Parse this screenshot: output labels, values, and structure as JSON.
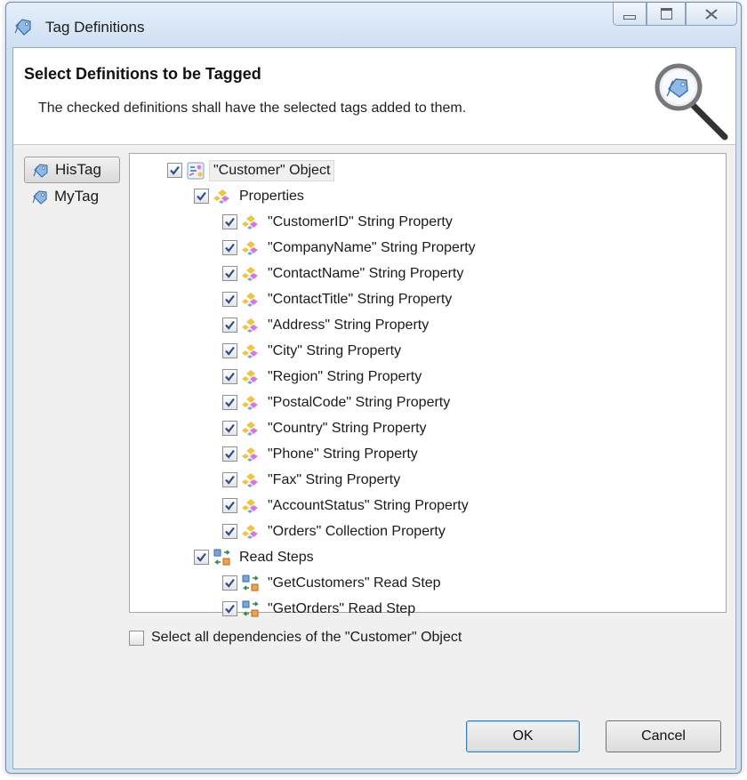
{
  "window": {
    "title": "Tag Definitions",
    "controls": [
      "minimize-icon",
      "maximize-icon",
      "close-icon"
    ],
    "close_glyph": "☒"
  },
  "header": {
    "title": "Select Definitions to be Tagged",
    "description": "The checked definitions shall have the selected tags added to them."
  },
  "tags": [
    {
      "label": "HisTag",
      "selected": true
    },
    {
      "label": "MyTag",
      "selected": false
    }
  ],
  "tree": {
    "root": {
      "label": "\"Customer\" Object",
      "checked": true,
      "icon": "object-icon"
    },
    "properties": {
      "label": "Properties",
      "checked": true,
      "icon": "properties-icon",
      "items": [
        "\"CustomerID\" String Property",
        "\"CompanyName\" String Property",
        "\"ContactName\" String Property",
        "\"ContactTitle\" String Property",
        "\"Address\" String Property",
        "\"City\" String Property",
        "\"Region\" String Property",
        "\"PostalCode\" String Property",
        "\"Country\" String Property",
        "\"Phone\" String Property",
        "\"Fax\" String Property",
        "\"AccountStatus\" String Property",
        "\"Orders\" Collection Property"
      ]
    },
    "read_steps": {
      "label": "Read Steps",
      "checked": true,
      "icon": "read-step-icon",
      "items": [
        "\"GetCustomers\" Read Step",
        "\"GetOrders\" Read Step"
      ]
    }
  },
  "dependencies_checkbox": {
    "label": "Select all dependencies of the \"Customer\" Object",
    "checked": false
  },
  "buttons": {
    "ok": "OK",
    "cancel": "Cancel"
  }
}
